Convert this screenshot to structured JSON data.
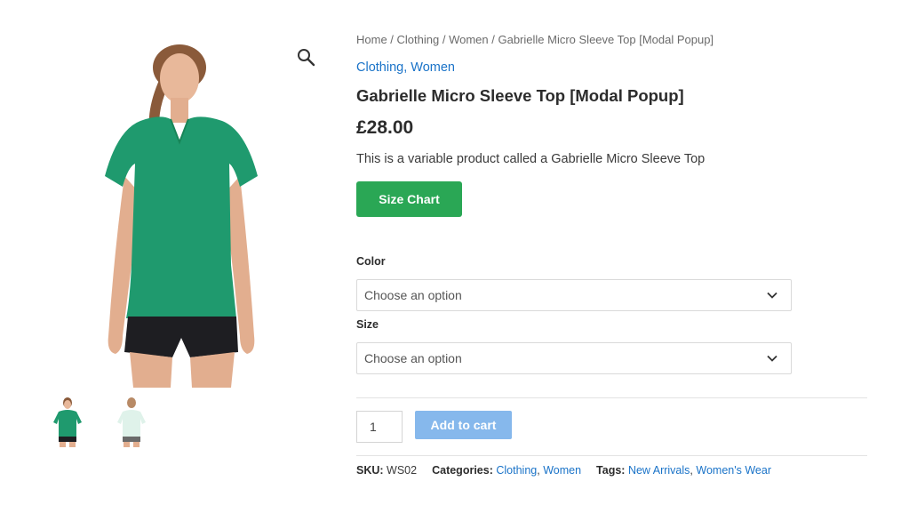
{
  "breadcrumb": {
    "home": "Home",
    "sep1": " / ",
    "clothing": "Clothing",
    "sep2": " / ",
    "women": "Women",
    "sep3": " / ",
    "current": "Gabrielle Micro Sleeve Top [Modal Popup]"
  },
  "categories_top": {
    "first": "Clothing",
    "comma": ",",
    "second": "Women"
  },
  "product": {
    "title": "Gabrielle Micro Sleeve Top [Modal Popup]",
    "price": "£28.00",
    "description": "This is a variable product called a Gabrielle Micro Sleeve Top",
    "size_chart_label": "Size Chart"
  },
  "variations": {
    "color_label": "Color",
    "color_value": "Choose an option",
    "size_label": "Size",
    "size_value": "Choose an option"
  },
  "cart": {
    "quantity": "1",
    "add_label": "Add to cart"
  },
  "meta": {
    "sku_label": "SKU:",
    "sku_value": "WS02",
    "categories_label": "Categories:",
    "cat1": "Clothing",
    "cat_comma": ",",
    "cat2": "Women",
    "tags_label": "Tags:",
    "tag1": "New Arrivals",
    "tag_comma": ",",
    "tag2": "Women's Wear"
  },
  "colors": {
    "accent_link": "#1a73c8",
    "size_chart_button": "#2aa755",
    "add_to_cart_button": "#86b8ec",
    "shirt_green": "#1f9a6e",
    "shirt_mint": "#dff2ea"
  },
  "icons": {
    "zoom": "magnifier-icon",
    "select": "chevron-down-icon"
  }
}
